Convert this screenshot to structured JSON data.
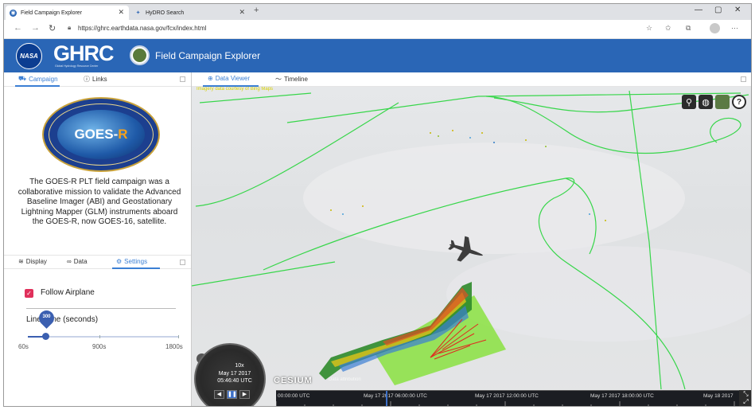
{
  "browser": {
    "tabs": [
      {
        "title": "Field Campaign Explorer",
        "active": true
      },
      {
        "title": "HyDRO Search",
        "active": false
      }
    ],
    "new_tab": "+",
    "url": "https://ghrc.earthdata.nasa.gov/fcx/index.html",
    "window_controls": [
      "—",
      "▢",
      "✕"
    ]
  },
  "app_header": {
    "nasa_logo": "NASA",
    "ghrc_logo": "GHRC",
    "ghrc_subtitle": "Global Hydrology Resource Center",
    "title": "Field Campaign Explorer",
    "header_color": "#2a66b6"
  },
  "campaign_panel": {
    "tabs": [
      {
        "label": "Campaign",
        "icon": "campaign-icon",
        "active": true
      },
      {
        "label": "Links",
        "icon": "info-icon",
        "active": false
      }
    ],
    "logo_text": "GOES-R",
    "description": "The GOES-R PLT field campaign was a collaborative mission to validate the Advanced Baseline Imager (ABI) and Geostationary Lightning Mapper (GLM) instruments aboard the GOES-R, now GOES-16, satellite."
  },
  "settings_panel": {
    "tabs": [
      {
        "label": "Display",
        "icon": "layers-icon",
        "active": false
      },
      {
        "label": "Data",
        "icon": "link-icon",
        "active": false
      },
      {
        "label": "Settings",
        "icon": "gear-icon",
        "active": true
      }
    ],
    "follow_airplane": {
      "label": "Follow Airplane",
      "checked": true
    },
    "line_time": {
      "label": "Line Time (seconds)",
      "value": "300",
      "min_label": "60s",
      "mid_label": "900s",
      "max_label": "1800s",
      "fraction": 0.138
    }
  },
  "viewer": {
    "tabs": [
      {
        "label": "Data Viewer",
        "icon": "globe-icon",
        "active": true
      },
      {
        "label": "Timeline",
        "icon": "timeline-icon",
        "active": false
      }
    ],
    "credit_text": "Imagery data courtesy of Bing Maps",
    "animation": {
      "speed": "10x",
      "date": "May 17 2017",
      "time": "05:46:40 UTC"
    },
    "cesium_logo": "CESIUM",
    "cesium_link": "Data attribution",
    "timeline_labels": [
      "00:00:00 UTC",
      "May 17 2017 06:00:00 UTC",
      "May 17 2017 12:00:00 UTC",
      "May 17 2017 18:00:00 UTC",
      "May 18 2017"
    ],
    "track_color": "#37d64a"
  }
}
